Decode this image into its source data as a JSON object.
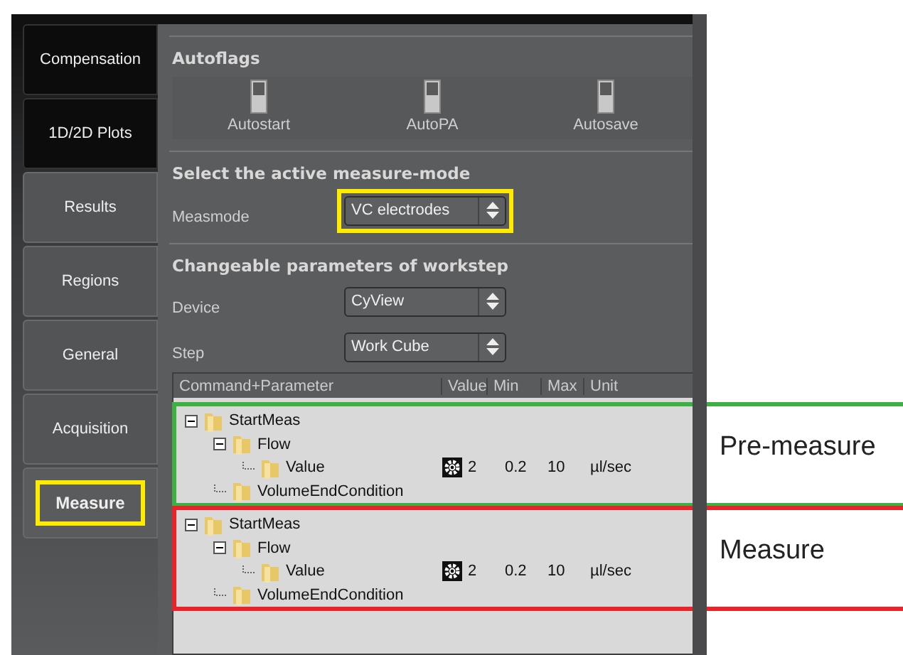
{
  "sidebar": {
    "tabs": [
      {
        "label": "Compensation",
        "selected": false,
        "highlighted": false
      },
      {
        "label": "1D/2D Plots",
        "selected": false,
        "highlighted": false
      },
      {
        "label": "Results",
        "selected": false,
        "highlighted": false
      },
      {
        "label": "Regions",
        "selected": false,
        "highlighted": false
      },
      {
        "label": "General",
        "selected": false,
        "highlighted": false
      },
      {
        "label": "Acquisition",
        "selected": false,
        "highlighted": false
      },
      {
        "label": "Measure",
        "selected": true,
        "highlighted": true
      }
    ]
  },
  "autoflags": {
    "title": "Autoflags",
    "flags": [
      {
        "label": "Autostart",
        "on": false
      },
      {
        "label": "AutoPA",
        "on": false
      },
      {
        "label": "Autosave",
        "on": false
      }
    ]
  },
  "measure_mode": {
    "title": "Select the active measure-mode",
    "label": "Measmode",
    "value": "VC electrodes",
    "highlighted": true
  },
  "workstep": {
    "title": "Changeable parameters of workstep",
    "fields": [
      {
        "label": "Device",
        "value": "CyView"
      },
      {
        "label": "Step",
        "value": "Work Cube"
      }
    ]
  },
  "table": {
    "columns": [
      "Command+Parameter",
      "Value",
      "Min",
      "Max",
      "Unit"
    ],
    "groups": [
      {
        "annotation": "Pre-measure",
        "color": "#3cb043",
        "nodes": [
          {
            "name": "StartMeas",
            "expanded": true,
            "children": [
              {
                "name": "Flow",
                "expanded": true,
                "children": [
                  {
                    "name": "Value",
                    "value": "2",
                    "min": "0.2",
                    "max": "10",
                    "unit": "µl/sec"
                  }
                ]
              },
              {
                "name": "VolumeEndCondition"
              }
            ]
          }
        ]
      },
      {
        "annotation": "Measure",
        "color": "#e8242a",
        "nodes": [
          {
            "name": "StartMeas",
            "expanded": true,
            "children": [
              {
                "name": "Flow",
                "expanded": true,
                "children": [
                  {
                    "name": "Value",
                    "value": "2",
                    "min": "0.2",
                    "max": "10",
                    "unit": "µl/sec"
                  }
                ]
              },
              {
                "name": "VolumeEndCondition"
              }
            ]
          }
        ]
      }
    ]
  }
}
